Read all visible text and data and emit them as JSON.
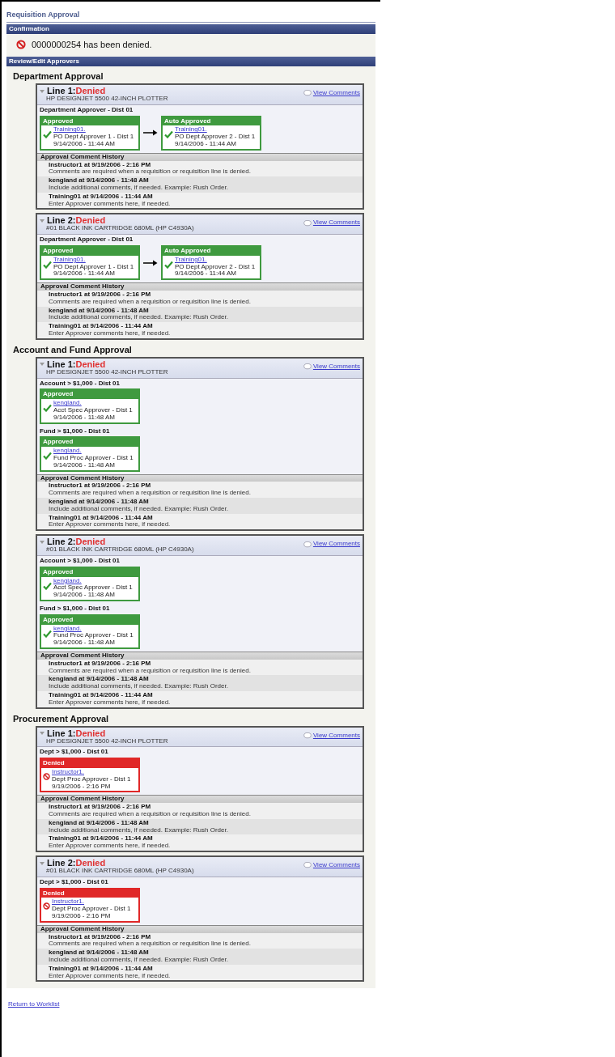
{
  "page_title": "Requisition Approval",
  "confirmation": {
    "header": "Confirmation",
    "message": "0000000254 has been denied."
  },
  "review": {
    "header": "Review/Edit Approvers",
    "sections": [
      {
        "title": "Department Approval",
        "lines": [
          {
            "line": "Line 1:",
            "status": "Denied",
            "item": "HP DESIGNJET 5500 42-INCH PLOTTER",
            "link": "View Comments",
            "stages": [
              {
                "label": "Department Approver - Dist 01",
                "approvers": [
                  {
                    "kind": "approved",
                    "status": "Approved",
                    "user": "Training01.",
                    "role": "PO Dept Approver 1 - Dist 1",
                    "date": "9/14/2006 - 11:44 AM"
                  },
                  {
                    "kind": "approved",
                    "status": "Auto Approved",
                    "user": "Training01.",
                    "role": "PO Dept Approver 2 - Dist 1",
                    "date": "9/14/2006 - 11:44 AM"
                  }
                ]
              }
            ],
            "history_title": "Approval Comment History",
            "comments": [
              {
                "header": "Instructor1 at 9/19/2006 - 2:16 PM",
                "text": "Comments are required when a requisition or requisition line is denied."
              },
              {
                "header": "kengland at 9/14/2006 - 11:48 AM",
                "text": "Include additional comments, if needed. Example: Rush Order."
              },
              {
                "header": "Training01 at 9/14/2006 - 11:44 AM",
                "text": "Enter Approver comments here, if needed."
              }
            ]
          },
          {
            "line": "Line 2:",
            "status": "Denied",
            "item": "#01 BLACK INK CARTRIDGE 680ML (HP C4930A)",
            "link": "View Comments",
            "stages": [
              {
                "label": "Department Approver - Dist 01",
                "approvers": [
                  {
                    "kind": "approved",
                    "status": "Approved",
                    "user": "Training01.",
                    "role": "PO Dept Approver 1 - Dist 1",
                    "date": "9/14/2006 - 11:44 AM"
                  },
                  {
                    "kind": "approved",
                    "status": "Auto Approved",
                    "user": "Training01.",
                    "role": "PO Dept Approver 2 - Dist 1",
                    "date": "9/14/2006 - 11:44 AM"
                  }
                ]
              }
            ],
            "history_title": "Approval Comment History",
            "comments": [
              {
                "header": "Instructor1 at 9/19/2006 - 2:16 PM",
                "text": "Comments are required when a requisition or requisition line is denied."
              },
              {
                "header": "kengland at 9/14/2006 - 11:48 AM",
                "text": "Include additional comments, if needed. Example: Rush Order."
              },
              {
                "header": "Training01 at 9/14/2006 - 11:44 AM",
                "text": "Enter Approver comments here, if needed."
              }
            ]
          }
        ]
      },
      {
        "title": "Account and Fund Approval",
        "lines": [
          {
            "line": "Line 1:",
            "status": "Denied",
            "item": "HP DESIGNJET 5500 42-INCH PLOTTER",
            "link": "View Comments",
            "stages": [
              {
                "label": "Account > $1,000 - Dist 01",
                "approvers": [
                  {
                    "kind": "approved",
                    "status": "Approved",
                    "user": "kengland.",
                    "role": "Acct Spec Approver - Dist 1",
                    "date": "9/14/2006 - 11:48 AM"
                  }
                ]
              },
              {
                "label": "Fund > $1,000 - Dist 01",
                "approvers": [
                  {
                    "kind": "approved",
                    "status": "Approved",
                    "user": "kengland.",
                    "role": "Fund Proc Approver - Dist 1",
                    "date": "9/14/2006 - 11:48 AM"
                  }
                ]
              }
            ],
            "history_title": "Approval Comment History",
            "comments": [
              {
                "header": "Instructor1 at 9/19/2006 - 2:16 PM",
                "text": "Comments are required when a requisition or requisition line is denied."
              },
              {
                "header": "kengland at 9/14/2006 - 11:48 AM",
                "text": "Include additional comments, if needed. Example: Rush Order."
              },
              {
                "header": "Training01 at 9/14/2006 - 11:44 AM",
                "text": "Enter Approver comments here, if needed."
              }
            ]
          },
          {
            "line": "Line 2:",
            "status": "Denied",
            "item": "#01 BLACK INK CARTRIDGE 680ML (HP C4930A)",
            "link": "View Comments",
            "stages": [
              {
                "label": "Account > $1,000 - Dist 01",
                "approvers": [
                  {
                    "kind": "approved",
                    "status": "Approved",
                    "user": "kengland.",
                    "role": "Acct Spec Approver - Dist 1",
                    "date": "9/14/2006 - 11:48 AM"
                  }
                ]
              },
              {
                "label": "Fund > $1,000 - Dist 01",
                "approvers": [
                  {
                    "kind": "approved",
                    "status": "Approved",
                    "user": "kengland.",
                    "role": "Fund Proc Approver - Dist 1",
                    "date": "9/14/2006 - 11:48 AM"
                  }
                ]
              }
            ],
            "history_title": "Approval Comment History",
            "comments": [
              {
                "header": "Instructor1 at 9/19/2006 - 2:16 PM",
                "text": "Comments are required when a requisition or requisition line is denied."
              },
              {
                "header": "kengland at 9/14/2006 - 11:48 AM",
                "text": "Include additional comments, if needed. Example: Rush Order."
              },
              {
                "header": "Training01 at 9/14/2006 - 11:44 AM",
                "text": "Enter Approver comments here, if needed."
              }
            ]
          }
        ]
      },
      {
        "title": "Procurement Approval",
        "lines": [
          {
            "line": "Line 1:",
            "status": "Denied",
            "item": "HP DESIGNJET 5500 42-INCH PLOTTER",
            "link": "View Comments",
            "stages": [
              {
                "label": "Dept > $1,000 - Dist 01",
                "approvers": [
                  {
                    "kind": "denied",
                    "status": "Denied",
                    "user": "Instructor1.",
                    "role": "Dept Proc Approver - Dist 1",
                    "date": "9/19/2006 - 2:16 PM"
                  }
                ]
              }
            ],
            "history_title": "Approval Comment History",
            "comments": [
              {
                "header": "Instructor1 at 9/19/2006 - 2:16 PM",
                "text": "Comments are required when a requisition or requisition line is denied."
              },
              {
                "header": "kengland at 9/14/2006 - 11:48 AM",
                "text": "Include additional comments, if needed. Example: Rush Order."
              },
              {
                "header": "Training01 at 9/14/2006 - 11:44 AM",
                "text": "Enter Approver comments here, if needed."
              }
            ]
          },
          {
            "line": "Line 2:",
            "status": "Denied",
            "item": "#01 BLACK INK CARTRIDGE 680ML (HP C4930A)",
            "link": "View Comments",
            "stages": [
              {
                "label": "Dept > $1,000 - Dist 01",
                "approvers": [
                  {
                    "kind": "denied",
                    "status": "Denied",
                    "user": "Instructor1.",
                    "role": "Dept Proc Approver - Dist 1",
                    "date": "9/19/2006 - 2:16 PM"
                  }
                ]
              }
            ],
            "history_title": "Approval Comment History",
            "comments": [
              {
                "header": "Instructor1 at 9/19/2006 - 2:16 PM",
                "text": "Comments are required when a requisition or requisition line is denied."
              },
              {
                "header": "kengland at 9/14/2006 - 11:48 AM",
                "text": "Include additional comments, if needed. Example: Rush Order."
              },
              {
                "header": "Training01 at 9/14/2006 - 11:44 AM",
                "text": "Enter Approver comments here, if needed."
              }
            ]
          }
        ]
      }
    ]
  },
  "footer_link": "Return to Worklist"
}
